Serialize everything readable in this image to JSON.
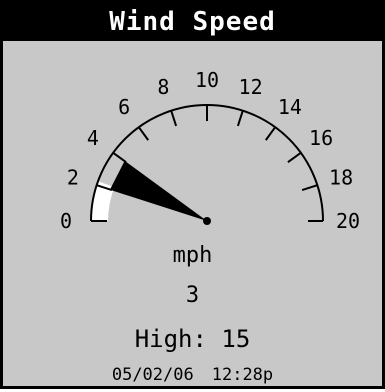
{
  "window": {
    "title": "Wind Speed"
  },
  "gauge": {
    "min": 0,
    "max": 20,
    "major_labels": [
      "0",
      "2",
      "4",
      "6",
      "8",
      "10",
      "12",
      "14",
      "16",
      "18",
      "20"
    ],
    "current_value": 3,
    "high_value": 15
  },
  "readout": {
    "unit": "mph",
    "value": "3",
    "high_label": "High:",
    "high_value": "15",
    "date": "05/02/06",
    "time": "12:28p"
  },
  "colors": {
    "background": "#c8c8c8",
    "title_bg": "#000000",
    "title_fg": "#ffffff",
    "needle_fill": "#000000",
    "arc_band": "#ffffff"
  }
}
